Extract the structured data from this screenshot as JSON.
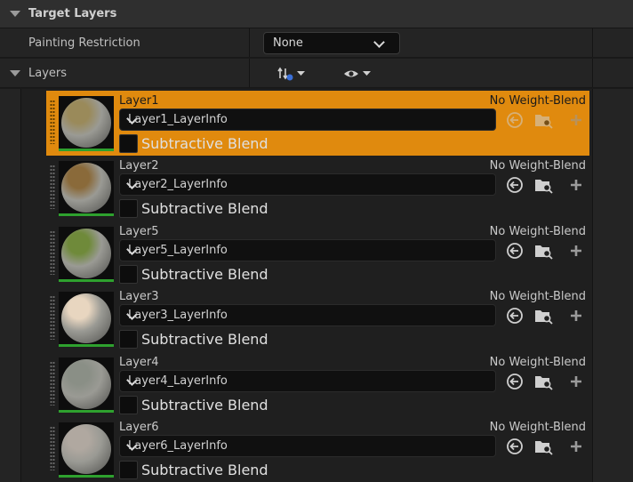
{
  "section": {
    "title": "Target Layers"
  },
  "painting_restriction": {
    "label": "Painting Restriction",
    "value": "None"
  },
  "layers_header": {
    "label": "Layers"
  },
  "layers": [
    {
      "name": "Layer1",
      "info": "Layer1_LayerInfo",
      "blend_mode": "No Weight-Blend",
      "subtractive_label": "Subtractive Blend",
      "selected": true,
      "top_color": "#9a8a5a"
    },
    {
      "name": "Layer2",
      "info": "Layer2_LayerInfo",
      "blend_mode": "No Weight-Blend",
      "subtractive_label": "Subtractive Blend",
      "selected": false,
      "top_color": "#8a6a3a"
    },
    {
      "name": "Layer5",
      "info": "Layer5_LayerInfo",
      "blend_mode": "No Weight-Blend",
      "subtractive_label": "Subtractive Blend",
      "selected": false,
      "top_color": "#6f8a3a"
    },
    {
      "name": "Layer3",
      "info": "Layer3_LayerInfo",
      "blend_mode": "No Weight-Blend",
      "subtractive_label": "Subtractive Blend",
      "selected": false,
      "top_color": "#e8d6c0"
    },
    {
      "name": "Layer4",
      "info": "Layer4_LayerInfo",
      "blend_mode": "No Weight-Blend",
      "subtractive_label": "Subtractive Blend",
      "selected": false,
      "top_color": "#8a8f86"
    },
    {
      "name": "Layer6",
      "info": "Layer6_LayerInfo",
      "blend_mode": "No Weight-Blend",
      "subtractive_label": "Subtractive Blend",
      "selected": false,
      "top_color": "#b0a8a0"
    }
  ],
  "colors": {
    "selected_accent": "#e08a0e",
    "layer_usage_bar": "#2ea12e"
  },
  "icons": {
    "sort": "sort-icon",
    "visibility": "eye-icon",
    "reset": "reset-arrow-icon",
    "browse": "folder-search-icon",
    "add": "plus-icon"
  }
}
